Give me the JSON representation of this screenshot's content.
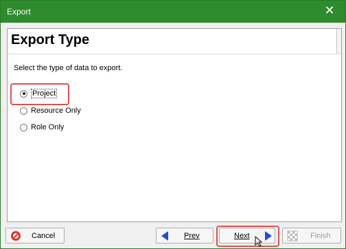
{
  "window": {
    "title": "Export",
    "close_glyph": "✕"
  },
  "page": {
    "title": "Export Type",
    "instruction": "Select the type of data to export."
  },
  "options": [
    {
      "label": "Project",
      "selected": true
    },
    {
      "label": "Resource Only",
      "selected": false
    },
    {
      "label": "Role Only",
      "selected": false
    }
  ],
  "buttons": {
    "cancel": "Cancel",
    "prev": "Prev",
    "next": "Next",
    "finish": "Finish"
  },
  "colors": {
    "titlebar": "#2e8b2e",
    "highlight": "#e05050"
  },
  "icons": {
    "cancel": "cancel-icon",
    "prev": "arrow-left-icon",
    "next": "arrow-right-icon",
    "finish": "checkered-flag-icon"
  }
}
